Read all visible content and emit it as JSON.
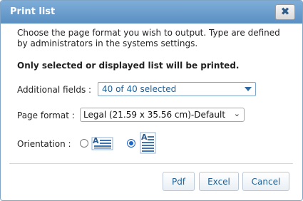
{
  "dialog": {
    "title": "Print list",
    "close_label": "✖",
    "description": "Choose the page format you wish to output. Type are defined by administrators in the systems settings.",
    "notice": "Only selected or displayed list will be printed."
  },
  "fields": {
    "additional_fields_label": "Additional fields :",
    "additional_fields_value": "40 of 40 selected",
    "page_format_label": "Page format :",
    "page_format_value": "Legal (21.59 x 35.56 cm)-Default",
    "orientation_label": "Orientation :",
    "orientation_options": [
      "landscape",
      "portrait"
    ],
    "orientation_selected": "portrait"
  },
  "buttons": {
    "pdf": "Pdf",
    "excel": "Excel",
    "cancel": "Cancel"
  },
  "icons": {
    "close": "close-icon",
    "landscape": "landscape-page-icon",
    "portrait": "portrait-page-icon"
  },
  "colors": {
    "titlebar": "#6a9dcf",
    "accent": "#1f5f95"
  }
}
